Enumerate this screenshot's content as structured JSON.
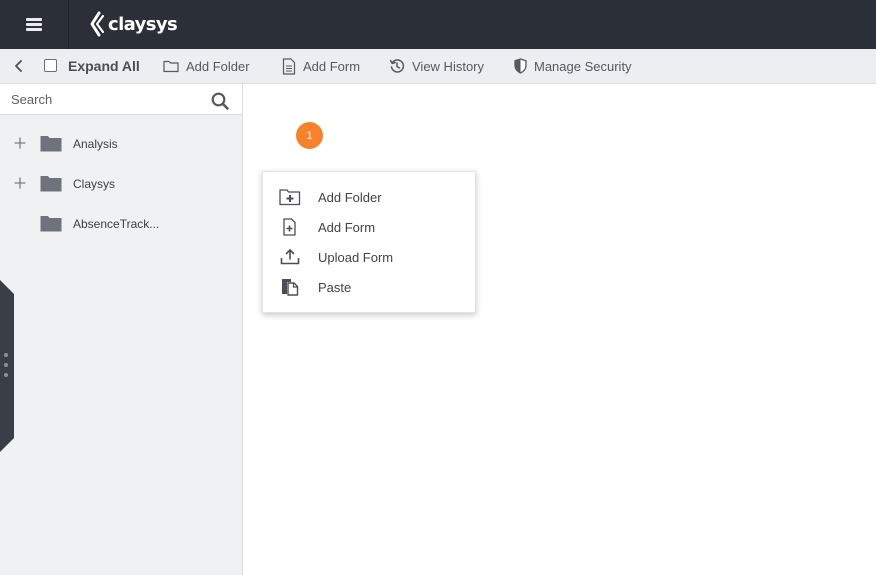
{
  "app": {
    "logo_text": "claysys"
  },
  "toolbar": {
    "expand_all_label": "Expand All",
    "add_folder_label": "Add Folder",
    "add_form_label": "Add Form",
    "view_history_label": "View History",
    "manage_security_label": "Manage Security"
  },
  "sidebar": {
    "search": {
      "placeholder": "Search"
    },
    "items": [
      {
        "label": "Analysis",
        "expandable": true
      },
      {
        "label": "Claysys",
        "expandable": true
      },
      {
        "label": "AbsenceTrack...",
        "expandable": false
      }
    ]
  },
  "badge": {
    "count": "1"
  },
  "context_menu": {
    "items": [
      {
        "label": "Add Folder",
        "icon": "folder-plus-icon"
      },
      {
        "label": "Add Form",
        "icon": "file-plus-icon"
      },
      {
        "label": "Upload Form",
        "icon": "upload-icon"
      },
      {
        "label": "Paste",
        "icon": "paste-icon"
      }
    ]
  },
  "colors": {
    "topbar": "#2b2f38",
    "toolbar": "#eceef1",
    "sidebar": "#f0f1f3",
    "badge": "#f7822a",
    "folder": "#6e737b"
  }
}
